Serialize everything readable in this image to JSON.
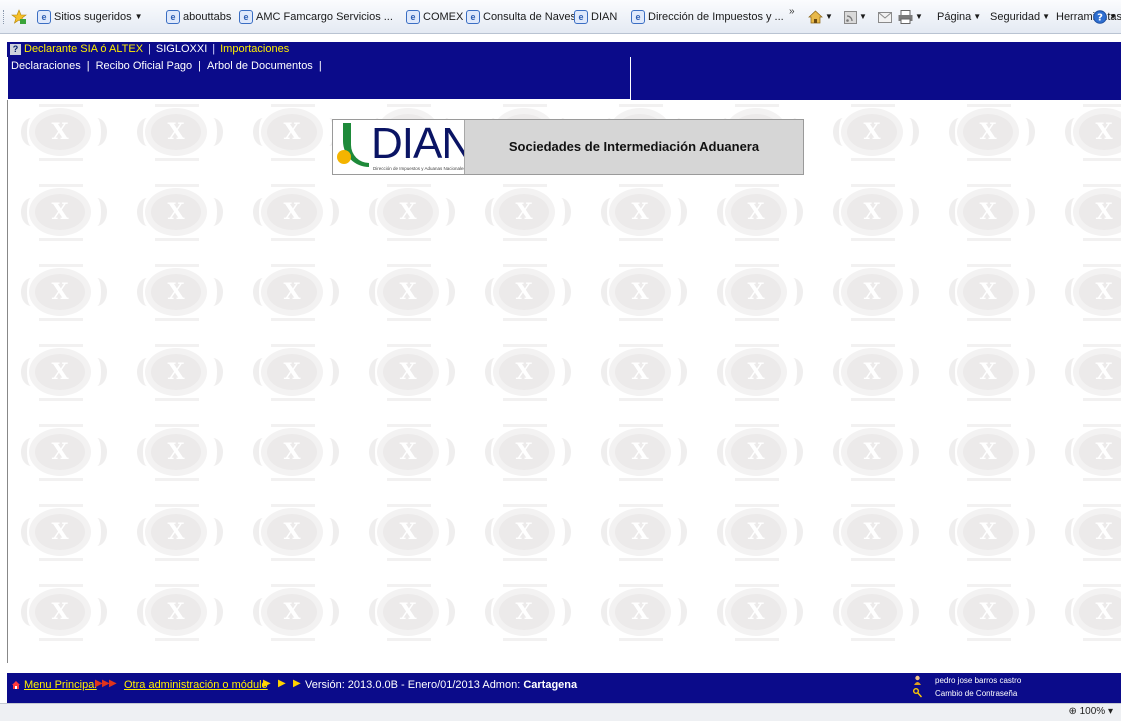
{
  "ie_toolbar": {
    "favorites": [
      {
        "label": "Sitios sugeridos",
        "dropdown": true
      },
      {
        "label": "abouttabs",
        "dropdown": false
      },
      {
        "label": "AMC Famcargo Servicios ...",
        "dropdown": false
      },
      {
        "label": "COMEX",
        "dropdown": false
      },
      {
        "label": "Consulta de Naves",
        "dropdown": false
      },
      {
        "label": "DIAN",
        "dropdown": false
      },
      {
        "label": "Dirección de Impuestos y ...",
        "dropdown": false
      }
    ],
    "more_chevron": "»",
    "tools": {
      "page": "Página",
      "security": "Seguridad",
      "tools": "Herramientas"
    }
  },
  "app_nav": {
    "help_glyph": "?",
    "primary": [
      "Declarante SIA ó ALTEX",
      "SIGLOXXI",
      "Importaciones"
    ],
    "secondary": [
      "Declaraciones",
      "Recibo Oficial Pago",
      "Arbol de Documentos"
    ]
  },
  "banner": {
    "logo_word": "DIAN",
    "logo_subtitle": "Dirección de Impuestos y Aduanas Nacionales",
    "title": "Sociedades de Intermediación Aduanera"
  },
  "status_bar": {
    "menu_link": "Menu Principal",
    "admin_link": "Otra administración o módulo",
    "version_text": "Versión: 2013.0.0B - Enero/01/2013 Admon:",
    "admon_name": "Cartagena",
    "user_name": "pedro jose barros castro",
    "change_password": "Cambio de Contraseña"
  },
  "zoom": "100%",
  "colors": {
    "nav_blue": "#0b0b8a",
    "nav_link_yellow": "#ffee00",
    "banner_gray": "#d6d6d6",
    "dian_green": "#1e8a3a"
  }
}
